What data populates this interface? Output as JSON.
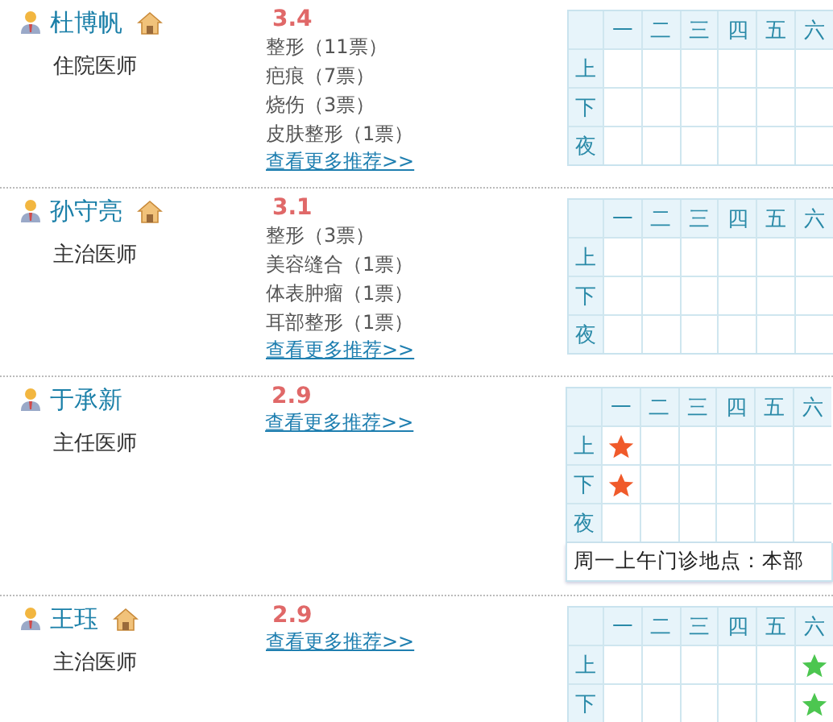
{
  "doctors": [
    {
      "name": "杜博帆",
      "has_home": true,
      "title": "住院医师",
      "score": "3.4",
      "tags": [
        "整形（11票）",
        "疤痕（7票）",
        "烧伤（3票）",
        "皮肤整形（1票）"
      ],
      "more_link": "查看更多推荐>>",
      "schedule": {
        "days": [
          "一",
          "二",
          "三",
          "四",
          "五",
          "六"
        ],
        "rows": [
          {
            "label": "上",
            "cells": [
              {
                "kind": "empty"
              },
              {
                "kind": "empty"
              },
              {
                "kind": "empty"
              },
              {
                "kind": "empty"
              },
              {
                "kind": "empty"
              },
              {
                "kind": "empty"
              }
            ]
          },
          {
            "label": "下",
            "cells": [
              {
                "kind": "empty"
              },
              {
                "kind": "empty"
              },
              {
                "kind": "empty"
              },
              {
                "kind": "empty"
              },
              {
                "kind": "empty"
              },
              {
                "kind": "empty"
              }
            ]
          },
          {
            "label": "夜",
            "cells": [
              {
                "kind": "empty"
              },
              {
                "kind": "empty"
              },
              {
                "kind": "empty"
              },
              {
                "kind": "empty"
              },
              {
                "kind": "empty"
              },
              {
                "kind": "empty"
              }
            ]
          }
        ]
      }
    },
    {
      "name": "孙守亮",
      "has_home": true,
      "title": "主治医师",
      "score": "3.1",
      "tags": [
        "整形（3票）",
        "美容缝合（1票）",
        "体表肿瘤（1票）",
        "耳部整形（1票）"
      ],
      "more_link": "查看更多推荐>>",
      "schedule": {
        "days": [
          "一",
          "二",
          "三",
          "四",
          "五",
          "六"
        ],
        "rows": [
          {
            "label": "上",
            "cells": [
              {
                "kind": "empty"
              },
              {
                "kind": "empty"
              },
              {
                "kind": "empty"
              },
              {
                "kind": "empty"
              },
              {
                "kind": "empty"
              },
              {
                "kind": "empty"
              }
            ]
          },
          {
            "label": "下",
            "cells": [
              {
                "kind": "empty"
              },
              {
                "kind": "empty"
              },
              {
                "kind": "empty"
              },
              {
                "kind": "empty"
              },
              {
                "kind": "empty"
              },
              {
                "kind": "empty"
              }
            ]
          },
          {
            "label": "夜",
            "cells": [
              {
                "kind": "empty"
              },
              {
                "kind": "empty"
              },
              {
                "kind": "empty"
              },
              {
                "kind": "empty"
              },
              {
                "kind": "empty"
              },
              {
                "kind": "empty"
              }
            ]
          }
        ]
      }
    },
    {
      "name": "于承新",
      "has_home": false,
      "title": "主任医师",
      "score": "2.9",
      "more_link": "查看更多推荐>>",
      "schedule": {
        "days": [
          "一",
          "二",
          "三",
          "四",
          "五",
          "六"
        ],
        "rows": [
          {
            "label": "上",
            "cells": [
              {
                "kind": "star",
                "color": "#f05a2a"
              },
              {
                "kind": "empty"
              },
              {
                "kind": "empty"
              },
              {
                "kind": "empty"
              },
              {
                "kind": "empty"
              },
              {
                "kind": "empty"
              }
            ]
          },
          {
            "label": "下",
            "cells": [
              {
                "kind": "star",
                "color": "#f05a2a"
              },
              {
                "kind": "empty"
              },
              {
                "kind": "empty"
              },
              {
                "kind": "empty"
              },
              {
                "kind": "empty"
              },
              {
                "kind": "empty"
              }
            ]
          },
          {
            "label": "夜",
            "cells": [
              {
                "kind": "empty"
              },
              {
                "kind": "empty"
              },
              {
                "kind": "empty"
              },
              {
                "kind": "empty"
              },
              {
                "kind": "empty"
              },
              {
                "kind": "empty"
              }
            ]
          }
        ],
        "note": "周一上午门诊地点：本部"
      }
    },
    {
      "name": "王珏",
      "has_home": true,
      "title": "主治医师",
      "score": "2.9",
      "more_link": "查看更多推荐>>",
      "schedule": {
        "days": [
          "一",
          "二",
          "三",
          "四",
          "五",
          "六"
        ],
        "rows": [
          {
            "label": "上",
            "cells": [
              {
                "kind": "empty"
              },
              {
                "kind": "empty"
              },
              {
                "kind": "empty"
              },
              {
                "kind": "empty"
              },
              {
                "kind": "empty"
              },
              {
                "kind": "star",
                "color": "#4cc650"
              }
            ]
          },
          {
            "label": "下",
            "cells": [
              {
                "kind": "empty"
              },
              {
                "kind": "empty"
              },
              {
                "kind": "empty"
              },
              {
                "kind": "empty"
              },
              {
                "kind": "empty"
              },
              {
                "kind": "star",
                "color": "#4cc650"
              }
            ]
          }
        ]
      }
    }
  ]
}
